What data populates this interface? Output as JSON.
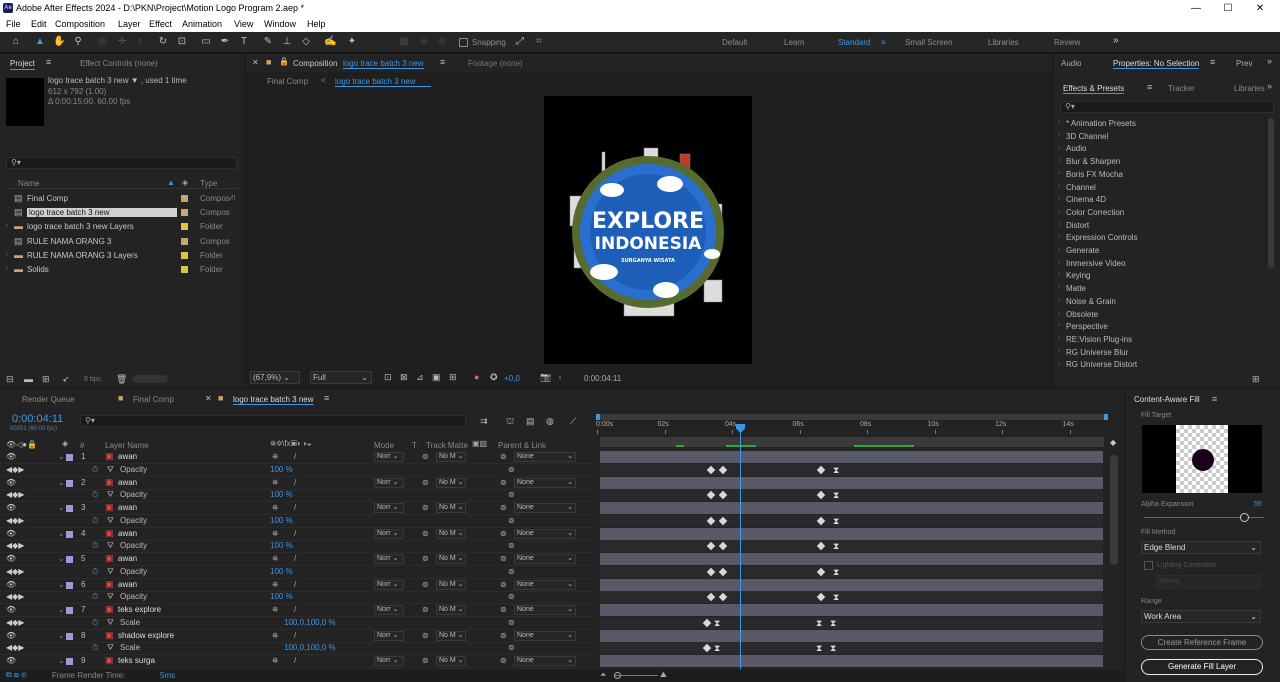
{
  "window": {
    "title": "Adobe After Effects 2024 - D:\\PKN\\Project\\Motion Logo Program 2.aep *",
    "app_icon": "Ae",
    "minimize": "—",
    "maximize": "☐",
    "close": "✕"
  },
  "menu": [
    "File",
    "Edit",
    "Composition",
    "Layer",
    "Effect",
    "Animation",
    "View",
    "Window",
    "Help"
  ],
  "toolbar": {
    "snapping": "Snapping",
    "workspaces": [
      "Default",
      "Learn",
      "Standard",
      "Small Screen",
      "Libraries",
      "Review"
    ],
    "active_workspace": "Standard"
  },
  "project_panel": {
    "tab_project": "Project",
    "tab_effect_controls": "Effect Controls (none)",
    "selected_name": "logo trace batch 3 new ▼ , used 1 time",
    "selected_dims": "612 x 792 (1.00)",
    "selected_duration": "Δ 0:00:15:00, 60,00 fps",
    "search_placeholder": "",
    "col_name": "Name",
    "col_type": "Type",
    "items": [
      {
        "name": "Final Comp",
        "type": "Compos",
        "kind": "comp",
        "color": "#c8a56b"
      },
      {
        "name": "logo trace batch 3 new",
        "type": "Compos",
        "kind": "comp",
        "color": "#c8a56b",
        "selected": true
      },
      {
        "name": "logo trace batch 3 new Layers",
        "type": "Folder",
        "kind": "folder",
        "color": "#e0c341"
      },
      {
        "name": "RULE NAMA ORANG 3",
        "type": "Compos",
        "kind": "comp",
        "color": "#c8a56b"
      },
      {
        "name": "RULE NAMA ORANG 3 Layers",
        "type": "Folder",
        "kind": "folder",
        "color": "#e0c341"
      },
      {
        "name": "Solids",
        "type": "Folder",
        "kind": "folder",
        "color": "#e0c341"
      }
    ],
    "bpc": "8 bpc"
  },
  "composition_panel": {
    "tab_prefix": "Composition",
    "tab_name": "logo trace batch 3 new",
    "footage_tab": "Footage (none)",
    "breadcrumbs": [
      "Final Comp",
      "logo trace batch 3 new"
    ],
    "zoom": "(67,9%)",
    "resolution": "Full",
    "exposure": "+0,0",
    "timecode": "0:00:04:11",
    "artwork": {
      "title_line1": "EXPLORE",
      "title_line2": "INDONESIA",
      "tagline": "SURGANYA WISATA"
    }
  },
  "right_panel": {
    "tabs_top": [
      "Audio",
      "Properties: No Selection",
      "Prev"
    ],
    "tabs_mid": [
      "Effects & Presets",
      "Tracker",
      "Libraries"
    ],
    "effects": [
      "* Animation Presets",
      "3D Channel",
      "Audio",
      "Blur & Sharpen",
      "Boris FX Mocha",
      "Channel",
      "Cinema 4D",
      "Color Correction",
      "Distort",
      "Expression Controls",
      "Generate",
      "Immersive Video",
      "Keying",
      "Matte",
      "Noise & Grain",
      "Obsolete",
      "Perspective",
      "RE:Vision Plug-ins",
      "RG Universe Blur",
      "RG Universe Distort"
    ]
  },
  "timeline": {
    "tabs": [
      "Render Queue",
      "Final Comp",
      "logo trace batch 3 new"
    ],
    "timecode": "0:00:04:11",
    "frame": "00251 (60.00 fps)",
    "headers": {
      "layer_name": "Layer Name",
      "mode": "Mode",
      "t": "T",
      "track_matte": "Track Matte",
      "parent": "Parent & Link"
    },
    "ruler": [
      "0:00s",
      "02s",
      "04s",
      "06s",
      "08s",
      "10s",
      "12s",
      "14s"
    ],
    "rows": [
      {
        "kind": "layer",
        "num": "1",
        "name": "awan",
        "mode": "Norr",
        "matte": "No M",
        "parent": "None"
      },
      {
        "kind": "prop",
        "name": "Opacity",
        "value": "100 %",
        "kfs": [
          108,
          120
        ],
        "kfs2": [
          218,
          235
        ]
      },
      {
        "kind": "layer",
        "num": "2",
        "name": "awan",
        "mode": "Norr",
        "matte": "No M",
        "parent": "None"
      },
      {
        "kind": "prop",
        "name": "Opacity",
        "value": "100 %",
        "kfs": [
          108,
          120
        ],
        "kfs2": [
          218,
          235
        ]
      },
      {
        "kind": "layer",
        "num": "3",
        "name": "awan",
        "mode": "Norr",
        "matte": "No M",
        "parent": "None"
      },
      {
        "kind": "prop",
        "name": "Opacity",
        "value": "100 %",
        "kfs": [
          108,
          120
        ],
        "kfs2": [
          218,
          235
        ]
      },
      {
        "kind": "layer",
        "num": "4",
        "name": "awan",
        "mode": "Norr",
        "matte": "No M",
        "parent": "None"
      },
      {
        "kind": "prop",
        "name": "Opacity",
        "value": "100 %",
        "kfs": [
          108,
          120
        ],
        "kfs2": [
          218,
          235
        ]
      },
      {
        "kind": "layer",
        "num": "5",
        "name": "awan",
        "mode": "Norr",
        "matte": "No M",
        "parent": "None"
      },
      {
        "kind": "prop",
        "name": "Opacity",
        "value": "100 %",
        "kfs": [
          108,
          120
        ],
        "kfs2": [
          218,
          235
        ]
      },
      {
        "kind": "layer",
        "num": "6",
        "name": "awan",
        "mode": "Norr",
        "matte": "No M",
        "parent": "None"
      },
      {
        "kind": "prop",
        "name": "Opacity",
        "value": "100 %",
        "kfs": [
          108,
          120
        ],
        "kfs2": [
          218,
          235
        ]
      },
      {
        "kind": "layer",
        "num": "7",
        "name": "teks explore",
        "mode": "Norr",
        "matte": "No M",
        "parent": "None"
      },
      {
        "kind": "prop",
        "name": "Scale",
        "value": "100,0,100,0 %",
        "kfs": [
          104
        ],
        "kfs2": [
          218,
          232
        ]
      },
      {
        "kind": "layer",
        "num": "8",
        "name": "shadow explore",
        "mode": "Norr",
        "matte": "No M",
        "parent": "None"
      },
      {
        "kind": "prop",
        "name": "Scale",
        "value": "100,0,100,0 %",
        "kfs": [
          104
        ],
        "kfs2": [
          218,
          232
        ]
      },
      {
        "kind": "layer",
        "num": "9",
        "name": "teks surga",
        "mode": "Norr",
        "matte": "No M",
        "parent": "None"
      }
    ],
    "status": "Frame Render Time:",
    "render_time": "5ms"
  },
  "content_aware": {
    "title": "Content-Aware Fill",
    "fill_target": "Fill Target",
    "alpha_expansion": "Alpha Expansion",
    "alpha_value": "55",
    "fill_method": "Fill Method",
    "method_value": "Edge Blend",
    "lighting": "Lighting Correction",
    "strength": "Strong",
    "range": "Range",
    "range_value": "Work Area",
    "create_ref": "Create Reference Frame",
    "generate": "Generate Fill Layer"
  }
}
